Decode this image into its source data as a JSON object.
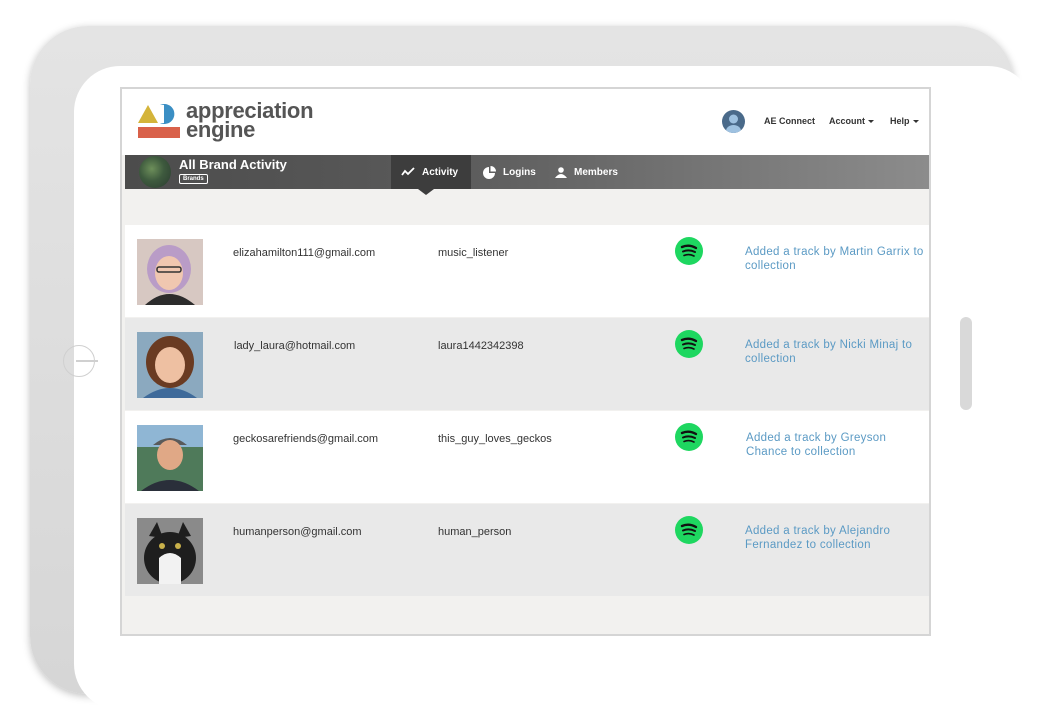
{
  "header": {
    "logo_line1": "appreciation",
    "logo_line2": "engine",
    "links": {
      "connect": "AE Connect",
      "account": "Account",
      "help": "Help"
    }
  },
  "nav": {
    "brand_title": "All Brand Activity",
    "brand_badge": "Brands",
    "tabs": [
      {
        "label": "Activity",
        "icon": "activity-chart-icon"
      },
      {
        "label": "Logins",
        "icon": "pie-chart-icon"
      },
      {
        "label": "Members",
        "icon": "person-icon"
      }
    ]
  },
  "rows": [
    {
      "email": "elizahamilton111@gmail.com",
      "username": "music_listener",
      "service_icon": "spotify-icon",
      "activity": "Added a track by Martin Garrix to collection"
    },
    {
      "email": "lady_laura@hotmail.com",
      "username": "laura1442342398",
      "service_icon": "spotify-icon",
      "activity": "Added a track by Nicki Minaj to collection"
    },
    {
      "email": "geckosarefriends@gmail.com",
      "username": "this_guy_loves_geckos",
      "service_icon": "spotify-icon",
      "activity": "Added a track by Greyson Chance to collection"
    },
    {
      "email": "humanperson@gmail.com",
      "username": "human_person",
      "service_icon": "spotify-icon",
      "activity": "Added a track by Alejandro Fernandez to collection"
    }
  ],
  "colors": {
    "accent": "#5b9ac4",
    "spotify": "#1ed760",
    "nav_dark": "#3d3d3d"
  }
}
